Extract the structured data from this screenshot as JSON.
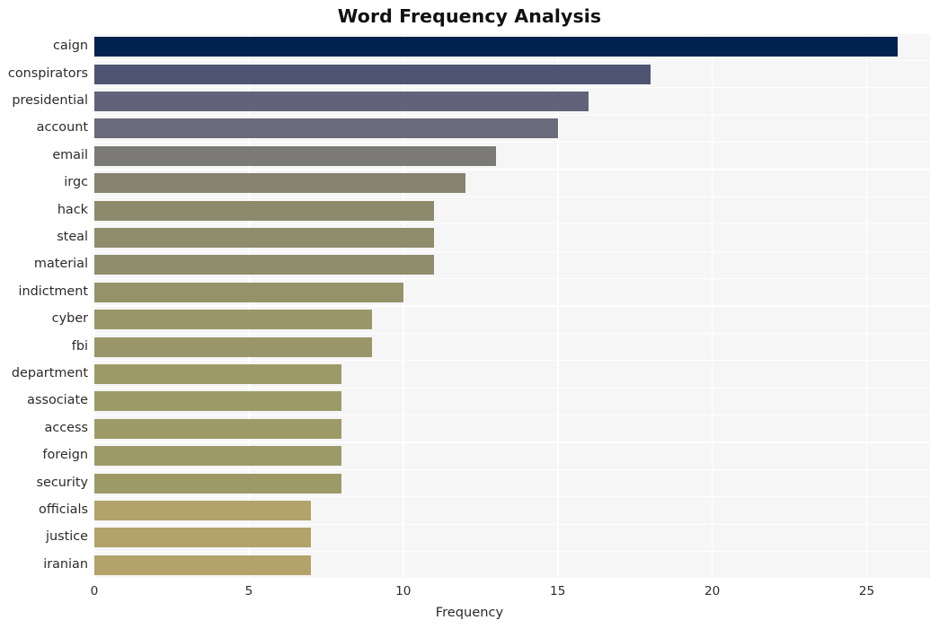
{
  "chart_data": {
    "type": "bar",
    "orientation": "horizontal",
    "title": "Word Frequency Analysis",
    "xlabel": "Frequency",
    "ylabel": "",
    "categories": [
      "caign",
      "conspirators",
      "presidential",
      "account",
      "email",
      "irgc",
      "hack",
      "steal",
      "material",
      "indictment",
      "cyber",
      "fbi",
      "department",
      "associate",
      "access",
      "foreign",
      "security",
      "officials",
      "justice",
      "iranian"
    ],
    "values": [
      26,
      18,
      16,
      15,
      13,
      12,
      11,
      11,
      11,
      10,
      9,
      9,
      8,
      8,
      8,
      8,
      8,
      7,
      7,
      7
    ],
    "bar_colors": [
      "#00224e",
      "#4f5472",
      "#62637a",
      "#6b6a7a",
      "#7b7a76",
      "#85836f",
      "#8c8a6d",
      "#8f8c6c",
      "#908d6b",
      "#95926a",
      "#9a9669",
      "#9a9669",
      "#9e9a68",
      "#9e9a68",
      "#9e9a68",
      "#9e9a68",
      "#9e9a68",
      "#b3a269",
      "#b3a269",
      "#b3a269"
    ],
    "xlim": [
      0,
      27.05
    ],
    "xticks": [
      0,
      5,
      10,
      15,
      20,
      25
    ],
    "xtick_labels": [
      "0",
      "5",
      "10",
      "15",
      "20",
      "25"
    ],
    "grid": true,
    "grid_color": "#ffffff",
    "plot_background": "#f6f6f7",
    "figure_background": "#ffffff",
    "legend": null,
    "colormap": "cividis"
  }
}
